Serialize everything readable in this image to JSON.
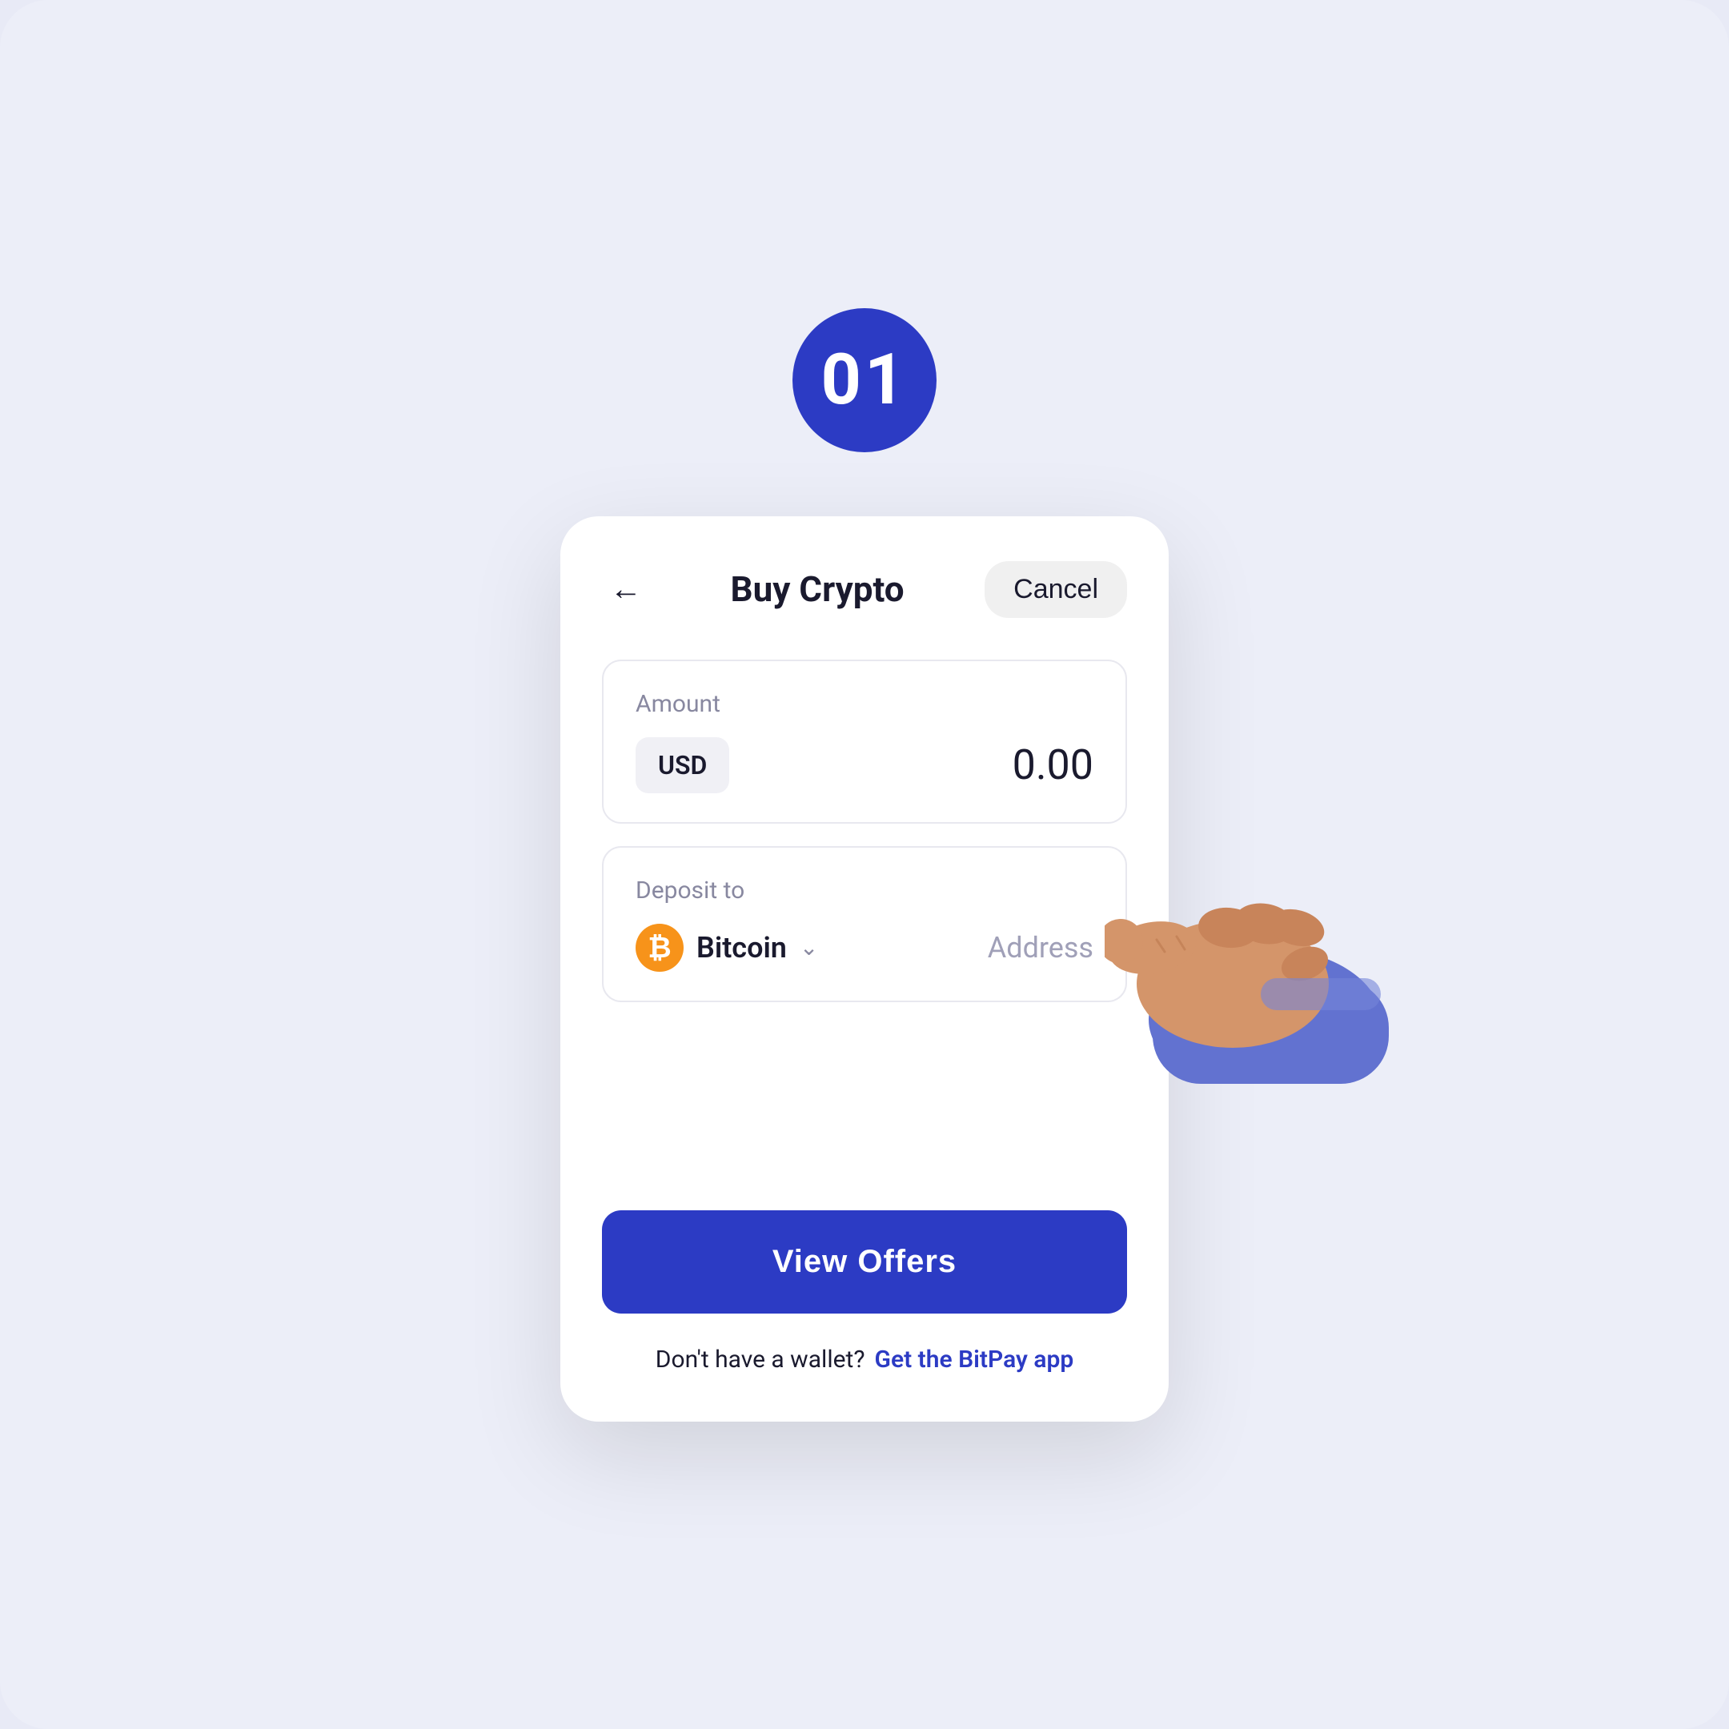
{
  "step": {
    "number": "01"
  },
  "header": {
    "title": "Buy Crypto",
    "cancel_label": "Cancel",
    "back_aria": "Back"
  },
  "amount_section": {
    "label": "Amount",
    "currency": "USD",
    "value": "0.00"
  },
  "deposit_section": {
    "label": "Deposit to",
    "crypto_name": "Bitcoin",
    "address_placeholder": "Address"
  },
  "actions": {
    "view_offers_label": "View Offers"
  },
  "footer": {
    "no_wallet_text": "Don't have a wallet?",
    "get_app_link": "Get the BitPay app"
  },
  "colors": {
    "primary": "#2c3bc4",
    "background": "#eceef8",
    "card_bg": "#ffffff",
    "bitcoin_orange": "#f7931a"
  }
}
